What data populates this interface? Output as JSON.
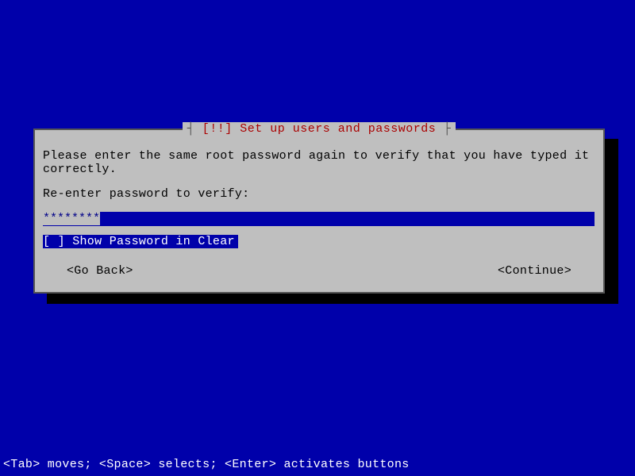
{
  "dialog": {
    "titlePrefix": "┤ ",
    "titleImportance": "[!!]",
    "titleText": " Set up users and passwords",
    "titleSuffix": " ├",
    "instruction": "Please enter the same root password again to verify that you have typed it correctly.",
    "prompt": "Re-enter password to verify:",
    "passwordMasked": "********",
    "checkboxState": "[ ]",
    "checkboxLabel": " Show Password in Clear",
    "goBack": "<Go Back>",
    "continue": "<Continue>"
  },
  "footer": {
    "text": "<Tab> moves; <Space> selects; <Enter> activates buttons"
  }
}
